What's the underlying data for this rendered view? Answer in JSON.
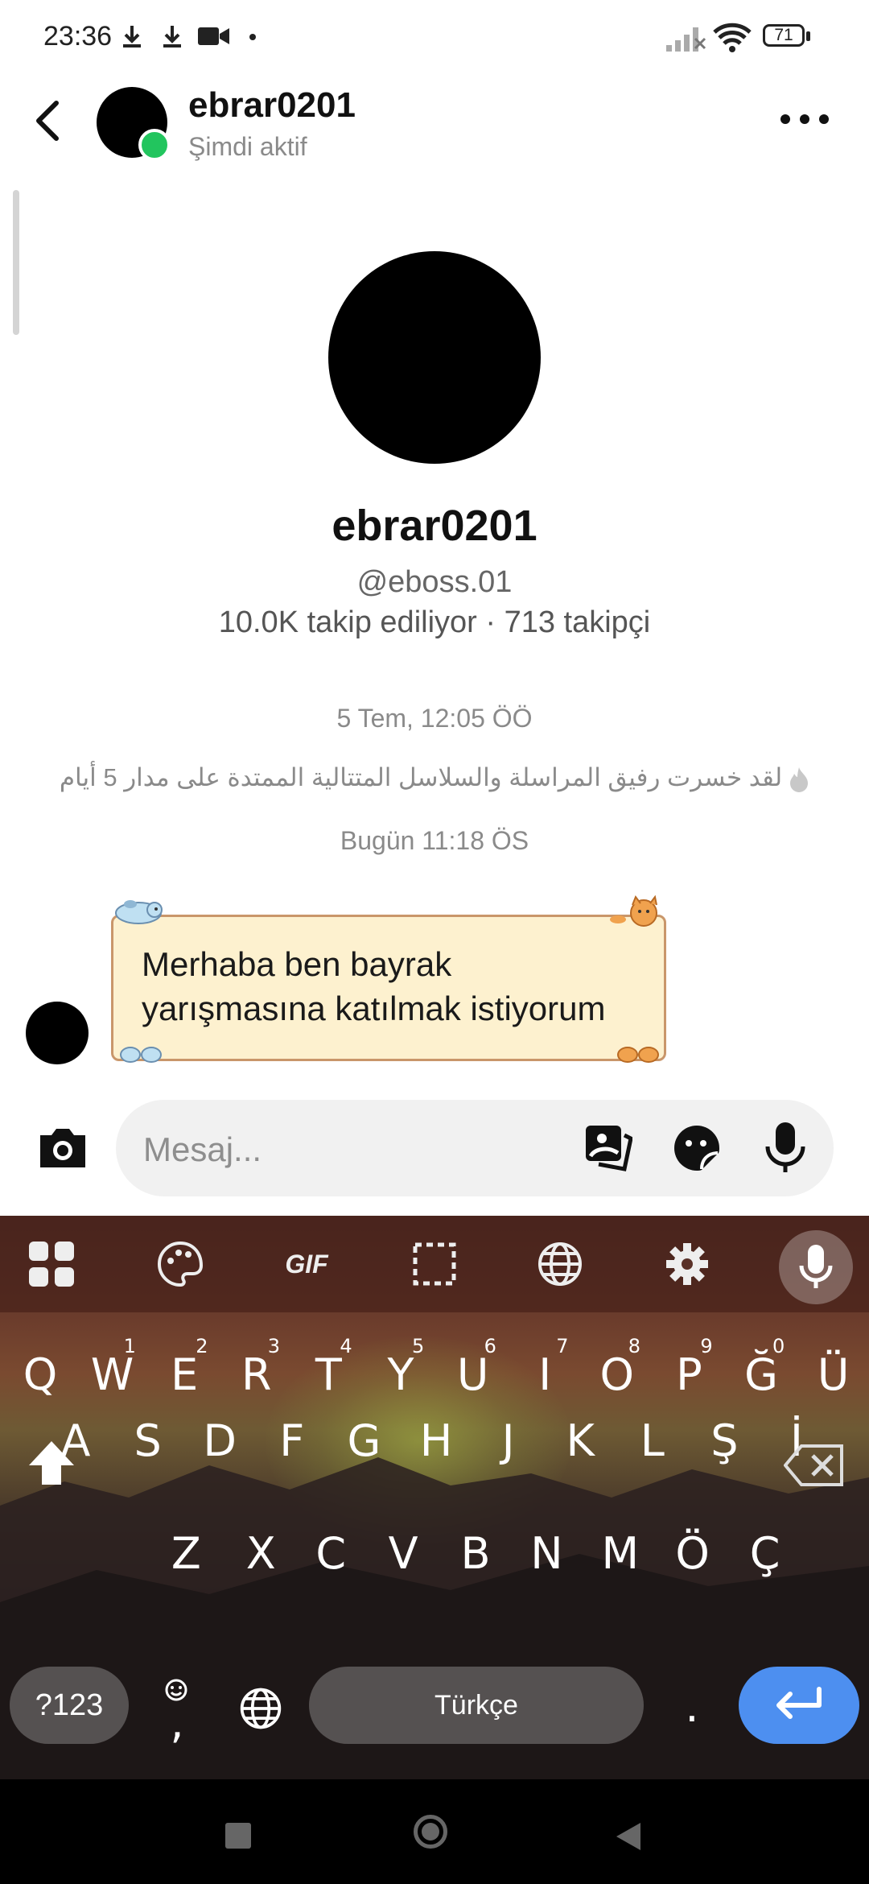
{
  "status_bar": {
    "time": "23:36",
    "battery": "71",
    "icons": [
      "download-icon",
      "download-icon",
      "video-camera-icon",
      "dot-icon",
      "signal-icon",
      "wifi-icon",
      "battery-icon"
    ]
  },
  "header": {
    "name": "ebrar0201",
    "status": "Şimdi aktif"
  },
  "profile": {
    "name": "ebrar0201",
    "handle": "@eboss.01",
    "stats": "10.0K takip ediliyor · 713 takipçi"
  },
  "chat": {
    "timestamp_1": "5 Tem, 12:05 ÖÖ",
    "system_message": "لقد خسرت رفيق المراسلة والسلاسل المتتالية الممتدة على مدار 5 أيام",
    "timestamp_2": "Bugün 11:18 ÖS",
    "message_line_1": "Merhaba ben bayrak",
    "message_line_2": "yarışmasına katılmak istiyorum"
  },
  "composer": {
    "placeholder": "Mesaj..."
  },
  "keyboard": {
    "toolbar_gif": "GIF",
    "row1": [
      "Q",
      "W",
      "E",
      "R",
      "T",
      "Y",
      "U",
      "I",
      "O",
      "P",
      "Ğ",
      "Ü"
    ],
    "row1_hints": [
      "1",
      "2",
      "3",
      "4",
      "5",
      "6",
      "7",
      "8",
      "9",
      "0"
    ],
    "row2": [
      "A",
      "S",
      "D",
      "F",
      "G",
      "H",
      "J",
      "K",
      "L",
      "Ş",
      "İ"
    ],
    "row3": [
      "Z",
      "X",
      "C",
      "V",
      "B",
      "N",
      "M",
      "Ö",
      "Ç"
    ],
    "symbols_label": "?123",
    "comma": ",",
    "space_label": "Türkçe",
    "period": ".",
    "colors": {
      "enter_key": "#4d8ff0",
      "pill_key": "rgba(255,255,255,0.25)"
    }
  },
  "colors": {
    "online": "#22c55e",
    "bubble_bg": "#fdf1cf",
    "bubble_border": "#c9966a"
  }
}
